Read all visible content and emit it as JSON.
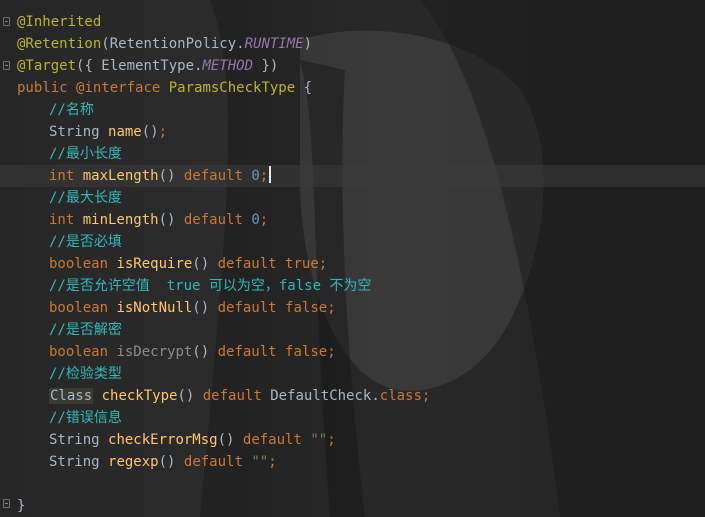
{
  "lines": [
    {
      "id": "inherited",
      "tokens": [
        {
          "t": "@Inherited",
          "c": "ann"
        }
      ]
    },
    {
      "id": "retention",
      "tokens": [
        {
          "t": "@Retention",
          "c": "ann"
        },
        {
          "t": "(RetentionPolicy.",
          "c": "ident"
        },
        {
          "t": "RUNTIME",
          "c": "const"
        },
        {
          "t": ")",
          "c": "ident"
        }
      ]
    },
    {
      "id": "target",
      "tokens": [
        {
          "t": "@Target",
          "c": "ann"
        },
        {
          "t": "({ ElementType.",
          "c": "ident"
        },
        {
          "t": "METHOD",
          "c": "const"
        },
        {
          "t": " })",
          "c": "ident"
        }
      ]
    },
    {
      "id": "declaration",
      "tokens": [
        {
          "t": "public ",
          "c": "kw"
        },
        {
          "t": "@interface ",
          "c": "kw"
        },
        {
          "t": "ParamsCheckType",
          "c": "iface"
        },
        {
          "t": " {",
          "c": "ident"
        }
      ]
    },
    {
      "id": "comment-name",
      "indent": 1,
      "tokens": [
        {
          "t": "//名称",
          "c": "comment"
        }
      ]
    },
    {
      "id": "name",
      "indent": 1,
      "tokens": [
        {
          "t": "String ",
          "c": "ident"
        },
        {
          "t": "name",
          "c": "meth"
        },
        {
          "t": "()",
          "c": "ident"
        },
        {
          "t": ";",
          "c": "kw"
        }
      ]
    },
    {
      "id": "comment-min",
      "indent": 1,
      "tokens": [
        {
          "t": "//最小长度",
          "c": "comment"
        }
      ]
    },
    {
      "id": "max-length",
      "indent": 1,
      "caret": true,
      "tokens": [
        {
          "t": "int ",
          "c": "kw"
        },
        {
          "t": "maxLength",
          "c": "meth"
        },
        {
          "t": "() ",
          "c": "ident"
        },
        {
          "t": "default ",
          "c": "kw"
        },
        {
          "t": "0",
          "c": "num"
        },
        {
          "t": ";",
          "c": "kw"
        }
      ]
    },
    {
      "id": "comment-max",
      "indent": 1,
      "tokens": [
        {
          "t": "//最大长度",
          "c": "comment"
        }
      ]
    },
    {
      "id": "min-length",
      "indent": 1,
      "tokens": [
        {
          "t": "int ",
          "c": "kw"
        },
        {
          "t": "minLength",
          "c": "meth"
        },
        {
          "t": "() ",
          "c": "ident"
        },
        {
          "t": "default ",
          "c": "kw"
        },
        {
          "t": "0",
          "c": "num"
        },
        {
          "t": ";",
          "c": "kw"
        }
      ]
    },
    {
      "id": "comment-require",
      "indent": 1,
      "tokens": [
        {
          "t": "//是否必填",
          "c": "comment"
        }
      ]
    },
    {
      "id": "is-require",
      "indent": 1,
      "tokens": [
        {
          "t": "boolean ",
          "c": "kw"
        },
        {
          "t": "isRequire",
          "c": "meth"
        },
        {
          "t": "() ",
          "c": "ident"
        },
        {
          "t": "default ",
          "c": "kw"
        },
        {
          "t": "true",
          "c": "kw"
        },
        {
          "t": ";",
          "c": "kw"
        }
      ]
    },
    {
      "id": "comment-null",
      "indent": 1,
      "tokens": [
        {
          "t": "//是否允许空值  true 可以为空，false 不为空",
          "c": "comment"
        }
      ]
    },
    {
      "id": "is-not-null",
      "indent": 1,
      "tokens": [
        {
          "t": "boolean ",
          "c": "kw"
        },
        {
          "t": "isNotNull",
          "c": "meth"
        },
        {
          "t": "() ",
          "c": "ident"
        },
        {
          "t": "default ",
          "c": "kw"
        },
        {
          "t": "false",
          "c": "kw"
        },
        {
          "t": ";",
          "c": "kw"
        }
      ]
    },
    {
      "id": "comment-decrypt",
      "indent": 1,
      "tokens": [
        {
          "t": "//是否解密",
          "c": "comment"
        }
      ]
    },
    {
      "id": "is-decrypt",
      "indent": 1,
      "tokens": [
        {
          "t": "boolean ",
          "c": "kw"
        },
        {
          "t": "isDecrypt",
          "c": "meth-unused"
        },
        {
          "t": "() ",
          "c": "ident"
        },
        {
          "t": "default ",
          "c": "kw"
        },
        {
          "t": "false",
          "c": "kw"
        },
        {
          "t": ";",
          "c": "kw"
        }
      ]
    },
    {
      "id": "comment-type",
      "indent": 1,
      "tokens": [
        {
          "t": "//检验类型",
          "c": "comment"
        }
      ]
    },
    {
      "id": "check-type",
      "indent": 1,
      "tokens": [
        {
          "t": "Class",
          "c": "class-hl"
        },
        {
          "t": " ",
          "c": "ident"
        },
        {
          "t": "checkType",
          "c": "meth"
        },
        {
          "t": "() ",
          "c": "ident"
        },
        {
          "t": "default ",
          "c": "kw"
        },
        {
          "t": "DefaultCheck.",
          "c": "ident"
        },
        {
          "t": "class",
          "c": "kw"
        },
        {
          "t": ";",
          "c": "kw"
        }
      ]
    },
    {
      "id": "comment-error",
      "indent": 1,
      "tokens": [
        {
          "t": "//错误信息",
          "c": "comment"
        }
      ]
    },
    {
      "id": "check-error-msg",
      "indent": 1,
      "tokens": [
        {
          "t": "String ",
          "c": "ident"
        },
        {
          "t": "checkErrorMsg",
          "c": "meth"
        },
        {
          "t": "() ",
          "c": "ident"
        },
        {
          "t": "default ",
          "c": "kw"
        },
        {
          "t": "\"\"",
          "c": "str"
        },
        {
          "t": ";",
          "c": "kw"
        }
      ]
    },
    {
      "id": "regexp",
      "indent": 1,
      "tokens": [
        {
          "t": "String ",
          "c": "ident"
        },
        {
          "t": "regexp",
          "c": "meth"
        },
        {
          "t": "() ",
          "c": "ident"
        },
        {
          "t": "default ",
          "c": "kw"
        },
        {
          "t": "\"\"",
          "c": "str"
        },
        {
          "t": ";",
          "c": "kw"
        }
      ]
    },
    {
      "id": "blank",
      "tokens": []
    },
    {
      "id": "closing-brace",
      "tokens": [
        {
          "t": "}",
          "c": "ident"
        }
      ]
    }
  ],
  "colors": {
    "annotation": "#bbb529",
    "keyword": "#cc7832",
    "comment": "#32b8b8",
    "method": "#ffc66d",
    "number": "#6897bb",
    "string": "#6a8759",
    "constant": "#9876aa"
  }
}
